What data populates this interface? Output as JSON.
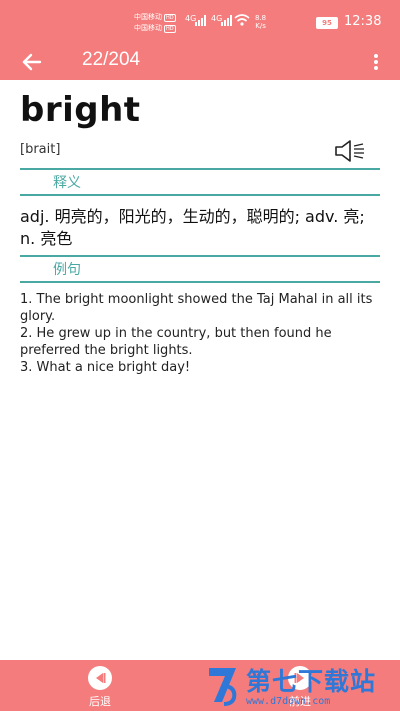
{
  "status_bar": {
    "carrier_1": "中国移动",
    "carrier_2": "中国移动",
    "hd_1": "HD",
    "hd_2": "HD",
    "net_1": "4G",
    "net_2": "4G",
    "speed_value": "8.8",
    "speed_unit": "K/s",
    "battery": "95",
    "time": "12:38"
  },
  "toolbar": {
    "counter": "22/204"
  },
  "word": {
    "text": "bright",
    "phonetic": "[brait]"
  },
  "sections": {
    "meaning_title": "释义",
    "meaning_text": "adj. 明亮的，阳光的，生动的，聪明的; adv. 亮; n. 亮色",
    "examples_title": "例句",
    "examples": [
      "1. The bright moonlight showed the Taj Mahal in all its glory.",
      "2. He grew up in the country, but then found he preferred the bright lights.",
      "3. What a nice bright day!"
    ]
  },
  "bottom_bar": {
    "prev_label": "后退",
    "next_label": "前进"
  },
  "watermark": {
    "title": "第七下载站",
    "url": "www.d7down.com"
  },
  "colors": {
    "accent": "#f47c7c",
    "section": "#4aa8a3"
  }
}
